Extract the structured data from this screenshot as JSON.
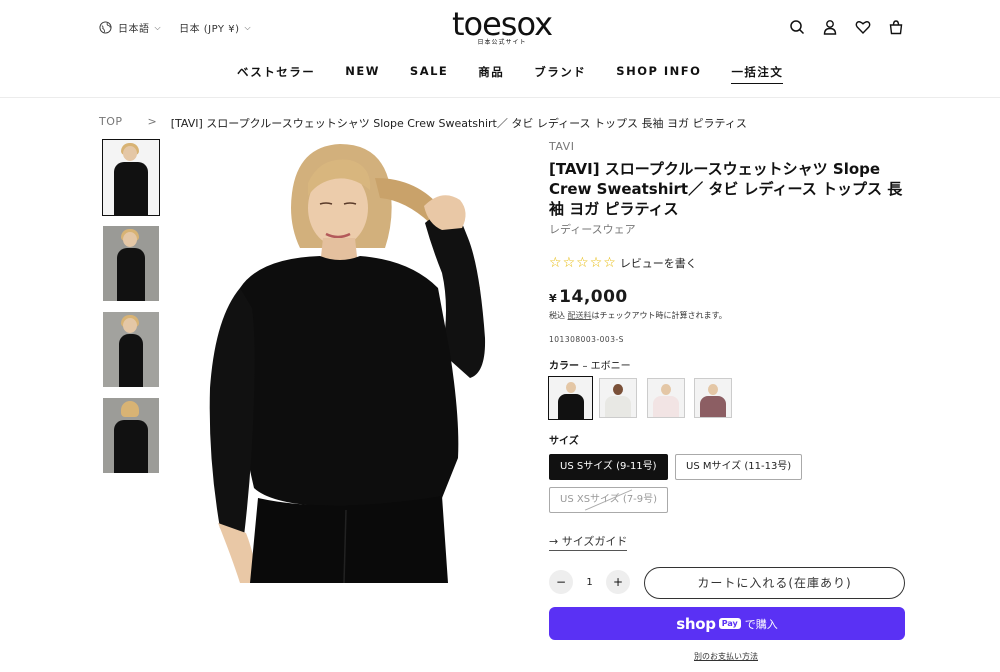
{
  "header": {
    "language": "日本語",
    "currency": "日本 (JPY ¥)",
    "logo_text": "toesox",
    "logo_subtitle": "日本公式サイト",
    "nav": [
      "ベストセラー",
      "NEW",
      "SALE",
      "商品",
      "ブランド",
      "SHOP INFO",
      "一括注文"
    ],
    "icons": [
      "search-icon",
      "account-icon",
      "wishlist-icon",
      "cart-icon"
    ]
  },
  "breadcrumb": {
    "home": "TOP",
    "separator": ">",
    "current": "[TAVI] スロープクルースウェットシャツ Slope Crew Sweatshirt／ タビ レディース トップス 長袖 ヨガ ピラティス"
  },
  "product": {
    "brand": "TAVI",
    "title": "[TAVI] スロープクルースウェットシャツ Slope Crew Sweatshirt／ タビ レディース トップス 長袖 ヨガ ピラティス",
    "category": "レディースウェア",
    "rating_stars": 0,
    "review_link": "レビューを書く",
    "price_symbol": "¥",
    "price": "14,000",
    "tax_prefix": "税込",
    "tax_link": "配送料",
    "tax_suffix": "はチェックアウト時に計算されます。",
    "sku": "101308003-003-S",
    "color_label": "カラー",
    "color_value": "– エボニー",
    "color_swatches": [
      {
        "body": "#111111"
      },
      {
        "body": "#e8e8e4"
      },
      {
        "body": "#f2e4e4"
      },
      {
        "body": "#8c5e63"
      }
    ],
    "size_label": "サイズ",
    "sizes": [
      "US Sサイズ (9-11号)",
      "US Mサイズ (11-13号)",
      "US XSサイズ (7-9号)"
    ],
    "size_guide": "→ サイズガイド",
    "quantity": "1",
    "qty_minus": "−",
    "qty_plus": "+",
    "add_to_cart": "カートに入れる(在庫あり)",
    "shoppay_brand": "shop",
    "shoppay_pay": "Pay",
    "shoppay_action": "で購入",
    "other_payment": "別のお支払い方法"
  },
  "colors": {
    "shoppay": "#5a31f4",
    "star": "#e6b800"
  }
}
